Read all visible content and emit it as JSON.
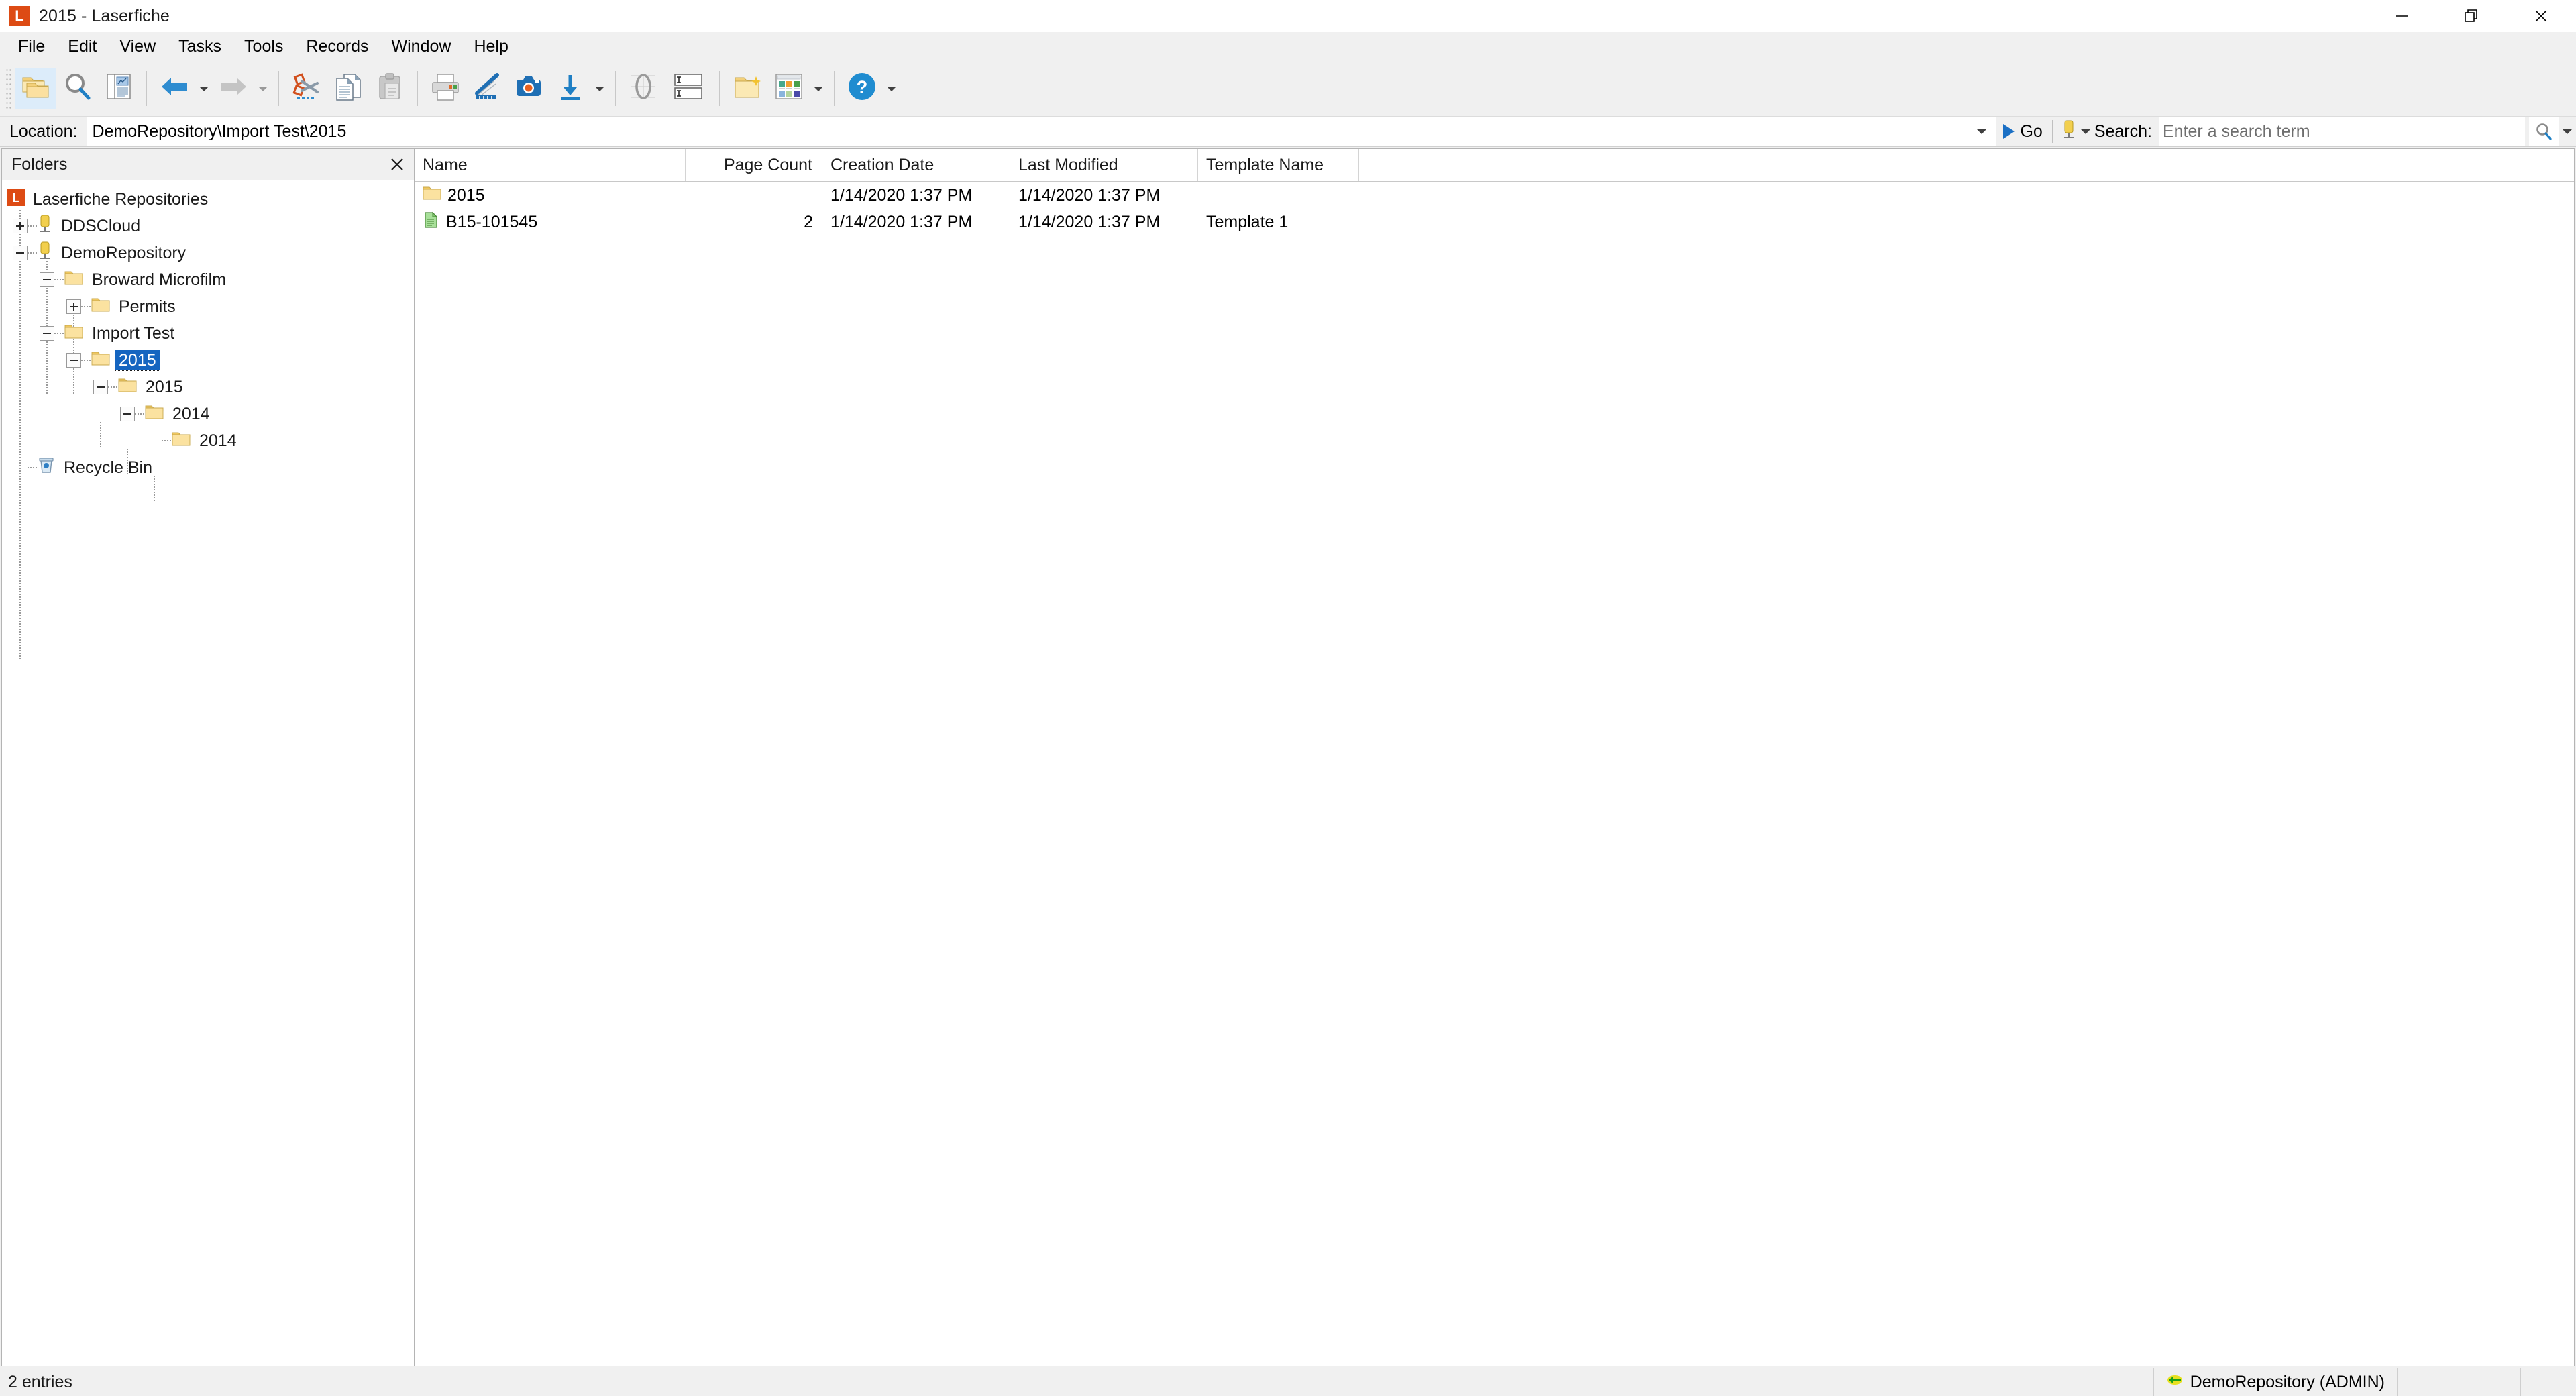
{
  "window": {
    "title": "2015 - Laserfiche",
    "logo_letter": "L",
    "logo_color": "#dd4b14",
    "controls": [
      {
        "name": "minimize-button",
        "glyph": "minimize"
      },
      {
        "name": "restore-button",
        "glyph": "restore"
      },
      {
        "name": "close-button",
        "glyph": "close"
      }
    ]
  },
  "menubar": {
    "items": [
      {
        "label": "File"
      },
      {
        "label": "Edit"
      },
      {
        "label": "View"
      },
      {
        "label": "Tasks"
      },
      {
        "label": "Tools"
      },
      {
        "label": "Records"
      },
      {
        "label": "Window"
      },
      {
        "label": "Help"
      }
    ]
  },
  "toolbar": {
    "buttons": [
      {
        "name": "folder-browser-button",
        "icon": "folders-icon",
        "active": true
      },
      {
        "name": "search-button",
        "icon": "magnifier-icon",
        "active": false
      },
      {
        "name": "document-view-button",
        "icon": "document-pane-icon",
        "active": false
      },
      {
        "name": "back-button",
        "icon": "back-arrow-icon",
        "active": false
      },
      {
        "name": "forward-button",
        "icon": "forward-arrow-icon",
        "active": false
      },
      {
        "name": "cut-button",
        "icon": "scissors-icon",
        "active": false
      },
      {
        "name": "copy-button",
        "icon": "copy-pages-icon",
        "active": false
      },
      {
        "name": "paste-button",
        "icon": "clipboard-icon",
        "active": false
      },
      {
        "name": "print-button",
        "icon": "printer-icon",
        "active": false
      },
      {
        "name": "annotate-button",
        "icon": "pen-highlight-icon",
        "active": false
      },
      {
        "name": "scan-button",
        "icon": "camera-icon",
        "active": false
      },
      {
        "name": "import-button",
        "icon": "download-arrow-icon",
        "active": false
      },
      {
        "name": "ocr-button",
        "icon": "ocr-zero-icon",
        "active": false
      },
      {
        "name": "fields-button",
        "icon": "text-fields-icon",
        "active": false
      },
      {
        "name": "new-folder-button",
        "icon": "new-folder-icon",
        "active": false
      },
      {
        "name": "thumbnails-button",
        "icon": "thumbnails-icon",
        "active": false
      },
      {
        "name": "help-button",
        "icon": "help-circle-icon",
        "active": false
      }
    ]
  },
  "location": {
    "label": "Location:",
    "value": "DemoRepository\\Import Test\\2015",
    "go_label": "Go",
    "dropdown_icon": "chevron-down-icon"
  },
  "search": {
    "label": "Search:",
    "placeholder": "Enter a search term",
    "value": "",
    "repository_icon": "repository-icon",
    "search_icon": "magnifier-icon"
  },
  "folders_panel": {
    "title": "Folders",
    "close_icon": "close-icon",
    "tree": [
      {
        "label": "Laserfiche Repositories",
        "icon": "laserfiche-logo-icon",
        "depth": 0,
        "toggle": "none",
        "selected": false
      },
      {
        "label": "DDSCloud",
        "icon": "repository-icon",
        "depth": 1,
        "toggle": "plus",
        "selected": false
      },
      {
        "label": "DemoRepository",
        "icon": "repository-icon",
        "depth": 1,
        "toggle": "minus",
        "selected": false
      },
      {
        "label": "Broward Microfilm",
        "icon": "folder-icon",
        "depth": 2,
        "toggle": "minus",
        "selected": false
      },
      {
        "label": "Permits",
        "icon": "folder-icon",
        "depth": 3,
        "toggle": "plus",
        "selected": false
      },
      {
        "label": "Import Test",
        "icon": "folder-icon",
        "depth": 2,
        "toggle": "minus",
        "selected": false
      },
      {
        "label": "2015",
        "icon": "folder-icon",
        "depth": 3,
        "toggle": "minus",
        "selected": true
      },
      {
        "label": "2015",
        "icon": "folder-icon",
        "depth": 4,
        "toggle": "minus",
        "selected": false
      },
      {
        "label": "2014",
        "icon": "folder-icon",
        "depth": 5,
        "toggle": "minus",
        "selected": false
      },
      {
        "label": "2014",
        "icon": "folder-icon",
        "depth": 6,
        "toggle": "none",
        "selected": false
      },
      {
        "label": "Recycle Bin",
        "icon": "recycle-bin-icon",
        "depth": 1,
        "toggle": "none",
        "selected": false
      }
    ]
  },
  "list_view": {
    "columns": [
      {
        "key": "name",
        "label": "Name",
        "align": "left"
      },
      {
        "key": "page_count",
        "label": "Page Count",
        "align": "right"
      },
      {
        "key": "creation_date",
        "label": "Creation Date",
        "align": "left"
      },
      {
        "key": "last_modified",
        "label": "Last Modified",
        "align": "left"
      },
      {
        "key": "template_name",
        "label": "Template Name",
        "align": "left"
      }
    ],
    "rows": [
      {
        "icon": "folder-icon",
        "name": "2015",
        "page_count": "",
        "creation_date": "1/14/2020 1:37 PM",
        "last_modified": "1/14/2020 1:37 PM",
        "template_name": ""
      },
      {
        "icon": "document-icon",
        "name": "B15-101545",
        "page_count": "2",
        "creation_date": "1/14/2020 1:37 PM",
        "last_modified": "1/14/2020 1:37 PM",
        "template_name": "Template 1"
      }
    ]
  },
  "statusbar": {
    "entries_text": "2 entries",
    "connection": "DemoRepository (ADMIN)",
    "connection_icon": "connected-icon"
  }
}
